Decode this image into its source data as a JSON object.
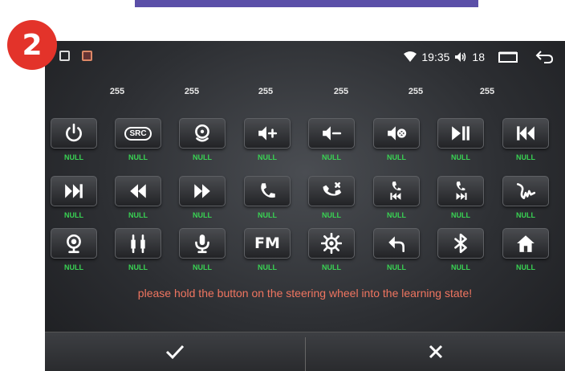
{
  "step_badge": "2",
  "status_bar": {
    "time": "19:35",
    "volume": "18"
  },
  "values": [
    "255",
    "255",
    "255",
    "255",
    "255",
    "255"
  ],
  "buttons": [
    {
      "name": "power",
      "icon": "power-icon",
      "label": "NULL"
    },
    {
      "name": "src",
      "icon": "src-icon",
      "text": "SRC",
      "label": "NULL"
    },
    {
      "name": "gps",
      "icon": "gps-icon",
      "label": "NULL"
    },
    {
      "name": "volume-up",
      "icon": "volume-up-icon",
      "label": "NULL"
    },
    {
      "name": "volume-down",
      "icon": "volume-down-icon",
      "label": "NULL"
    },
    {
      "name": "mute",
      "icon": "mute-icon",
      "label": "NULL"
    },
    {
      "name": "play-pause",
      "icon": "play-pause-icon",
      "label": "NULL"
    },
    {
      "name": "previous",
      "icon": "previous-icon",
      "label": "NULL"
    },
    {
      "name": "next",
      "icon": "next-icon",
      "label": "NULL"
    },
    {
      "name": "rewind",
      "icon": "rewind-icon",
      "label": "NULL"
    },
    {
      "name": "fast-forward",
      "icon": "fast-forward-icon",
      "label": "NULL"
    },
    {
      "name": "phone-answer",
      "icon": "phone-answer-icon",
      "label": "NULL"
    },
    {
      "name": "phone-hangup",
      "icon": "phone-hangup-icon",
      "label": "NULL"
    },
    {
      "name": "phone-previous",
      "icon": "phone-previous-icon",
      "label": "NULL"
    },
    {
      "name": "phone-next",
      "icon": "phone-next-icon",
      "label": "NULL"
    },
    {
      "name": "voice-control",
      "icon": "voice-wave-icon",
      "label": "NULL"
    },
    {
      "name": "camera",
      "icon": "camera-icon",
      "label": "NULL"
    },
    {
      "name": "aux-input",
      "icon": "rca-plug-icon",
      "label": "NULL"
    },
    {
      "name": "microphone",
      "icon": "microphone-icon",
      "label": "NULL"
    },
    {
      "name": "fm",
      "icon": "fm-icon",
      "text": "FM",
      "label": "NULL"
    },
    {
      "name": "settings",
      "icon": "gear-icon",
      "label": "NULL"
    },
    {
      "name": "back",
      "icon": "back-arrow-icon",
      "label": "NULL"
    },
    {
      "name": "bluetooth",
      "icon": "bluetooth-icon",
      "label": "NULL"
    },
    {
      "name": "home",
      "icon": "home-icon",
      "label": "NULL"
    }
  ],
  "prompt": "please hold the button on the steering wheel into the learning state!",
  "bottom_bar": {
    "confirm_icon": "checkmark-icon",
    "cancel_icon": "close-icon"
  },
  "colors": {
    "badge": "#e3332a",
    "null_label": "#39d353",
    "prompt_text": "#f07560",
    "banner": "#5b4fa8"
  }
}
